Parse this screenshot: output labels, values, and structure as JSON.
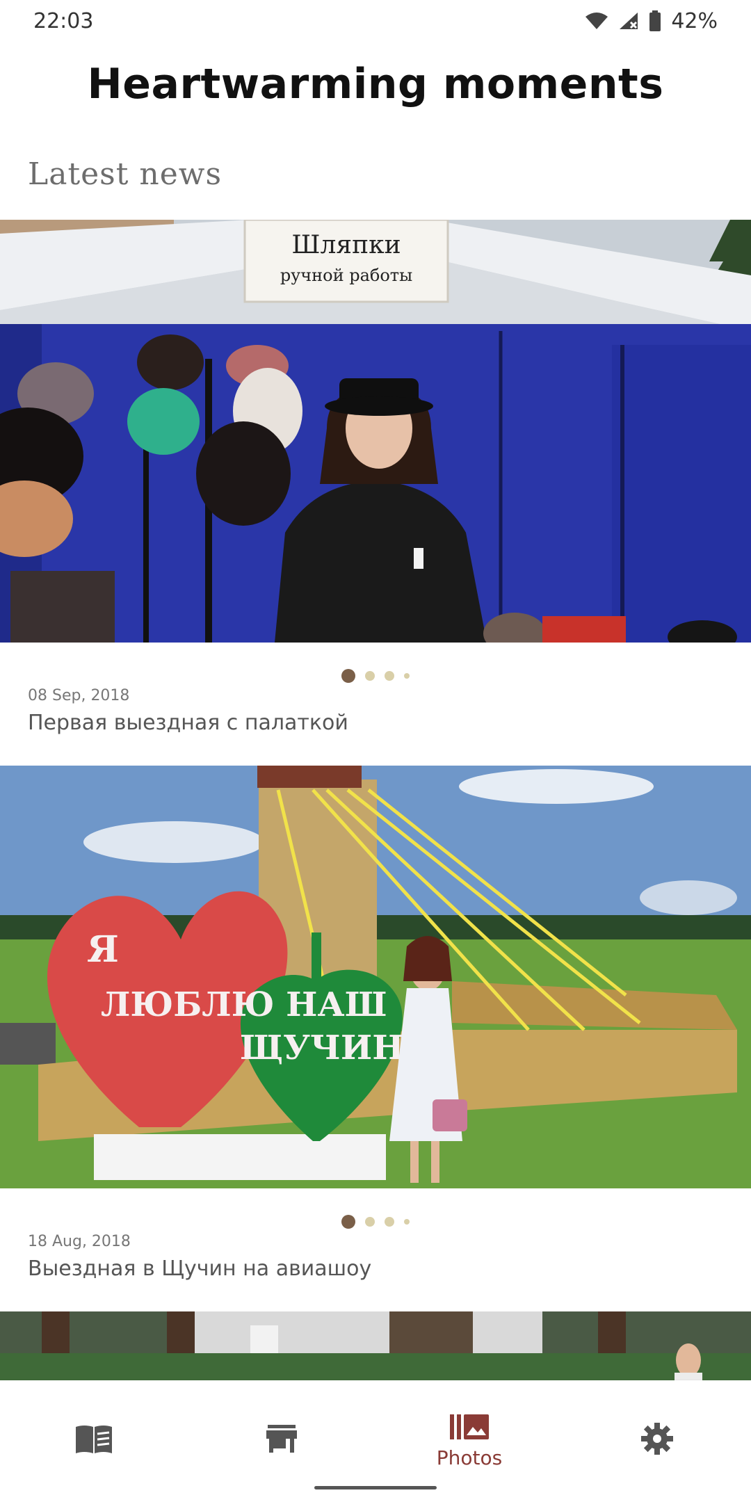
{
  "status": {
    "time": "22:03",
    "battery": "42%"
  },
  "header": {
    "title": "Heartwarming moments",
    "section": "Latest news"
  },
  "cards": [
    {
      "date": "08 Sep, 2018",
      "title": "Первая выездная с палаткой",
      "sign_line1": "Шляпки",
      "sign_line2": "ручной работы",
      "dots": {
        "count": 4,
        "active": 0
      }
    },
    {
      "date": "18 Aug, 2018",
      "title": "Выездная в Щучин на авиашоу",
      "heart_text1": "Я",
      "heart_text2": "ЛЮБЛЮ НАШ",
      "heart_text3": "ЩУЧИН!",
      "dots": {
        "count": 4,
        "active": 0
      }
    }
  ],
  "bottom_nav": {
    "items": [
      {
        "icon": "book-icon",
        "label": ""
      },
      {
        "icon": "store-icon",
        "label": ""
      },
      {
        "icon": "photos-icon",
        "label": "Photos"
      },
      {
        "icon": "gear-icon",
        "label": ""
      }
    ],
    "active_index": 2,
    "active_color": "#8a3b36",
    "inactive_color": "#555555"
  }
}
